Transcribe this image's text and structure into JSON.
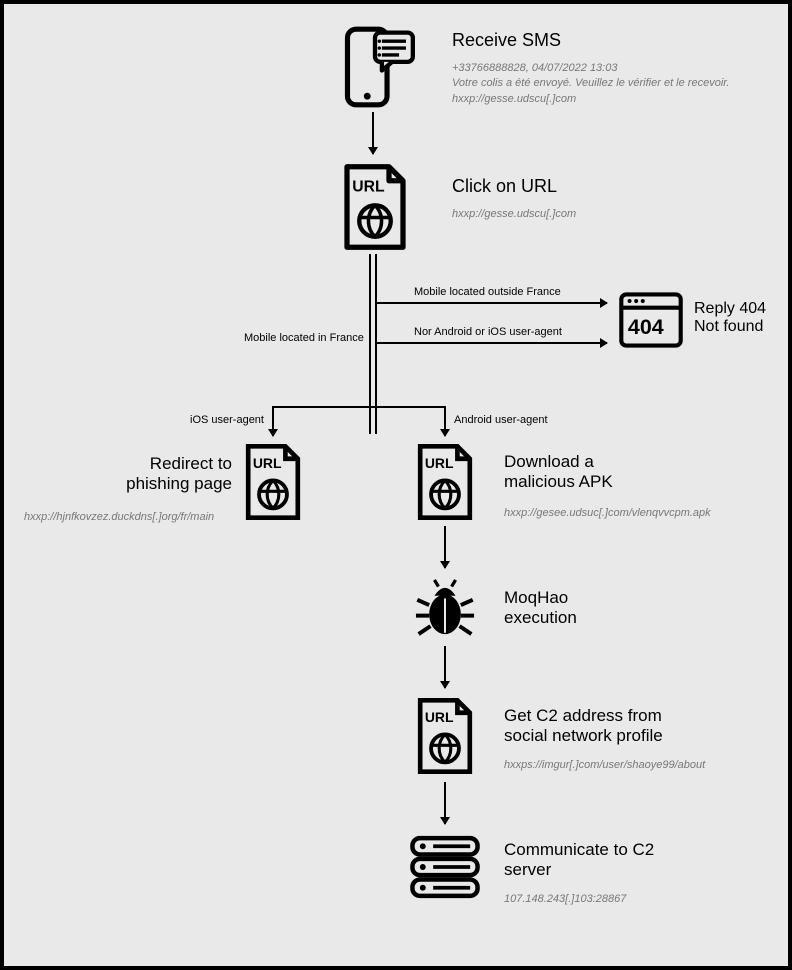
{
  "nodes": {
    "sms": {
      "title": "Receive SMS",
      "line1": "+33766888828, 04/07/2022 13:03",
      "line2": "Votre colis a été envoyé. Veuillez le vérifier et le recevoir.",
      "line3": "hxxp://gesse.udscu[.]com"
    },
    "click_url": {
      "title": "Click on URL",
      "sub": "hxxp://gesse.udscu[.]com"
    },
    "reply404": {
      "title1": "Reply 404",
      "title2": "Not found"
    },
    "redirect": {
      "title1": "Redirect to",
      "title2": "phishing page",
      "sub": "hxxp://hjnfkovzez.duckdns[.]org/fr/main"
    },
    "download_apk": {
      "title1": "Download a",
      "title2": "malicious APK",
      "sub": "hxxp://gesee.udsuc[.]com/vlenqvvcpm.apk"
    },
    "moqhao": {
      "title1": "MoqHao",
      "title2": "execution"
    },
    "c2_addr": {
      "title1": "Get C2 address from",
      "title2": "social network profile",
      "sub": "hxxps://imgur[.]com/user/shaoye99/about"
    },
    "c2_comm": {
      "title1": "Communicate to C2",
      "title2": "server",
      "sub": "107.148.243[.]103:28867"
    }
  },
  "edges": {
    "outside_france": "Mobile located outside France",
    "not_android_ios": "Nor Android or iOS user-agent",
    "in_france": "Mobile located in France",
    "ios_ua": "iOS user-agent",
    "android_ua": "Android user-agent"
  },
  "icons": {
    "phone_sms": "phone-sms-icon",
    "url_doc": "url-document-icon",
    "browser_404": "browser-404-icon",
    "bug": "bug-icon",
    "server": "server-icon"
  }
}
